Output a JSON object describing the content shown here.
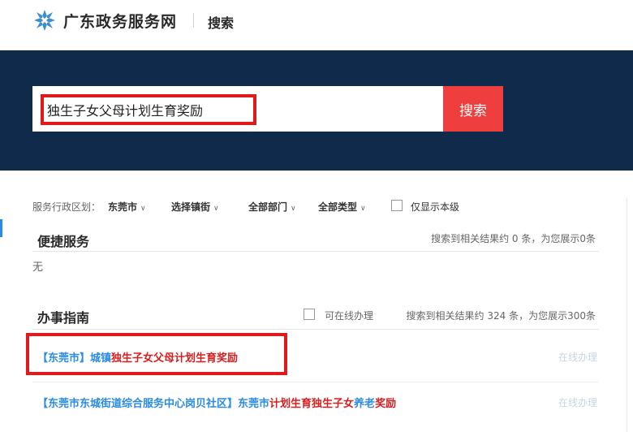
{
  "header": {
    "site_title": "广东政务服务网",
    "search_link": "搜索",
    "logo_icon": "snowflake-logo-icon"
  },
  "search": {
    "value": "独生子女父母计划生育奖励",
    "button_label": "搜索"
  },
  "filters": {
    "region_label": "服务行政区划：",
    "city": "东莞市",
    "town": "选择镇街",
    "department": "全部部门",
    "type": "全部类型",
    "local_only": "仅显示本级"
  },
  "convenient_services": {
    "title": "便捷服务",
    "summary": "搜索到相关结果约 0 条，为您展示0条",
    "empty_text": "无"
  },
  "guide": {
    "title": "办事指南",
    "online_filter": "可在线办理",
    "summary": "搜索到相关结果约 324 条，为您展示300条",
    "results": [
      {
        "prefix": "【东莞市】",
        "middle": "城镇",
        "highlight": "独生子女父母计划生育奖励",
        "suffix": "",
        "action": "在线办理"
      },
      {
        "prefix": "【东莞市东城街道综合服务中心岗贝社区】",
        "middle": "东莞市",
        "highlight": "计划生育独生子女",
        "mid2": "养老",
        "tail_highlight": "奖励",
        "action": "在线办理"
      }
    ]
  },
  "colors": {
    "hero_bg": "#0f2a4a",
    "search_button": "#ee3e3e",
    "link_blue": "#2a8be0",
    "keyword_red": "#d81e1e",
    "annotation_red": "#e0191b"
  }
}
